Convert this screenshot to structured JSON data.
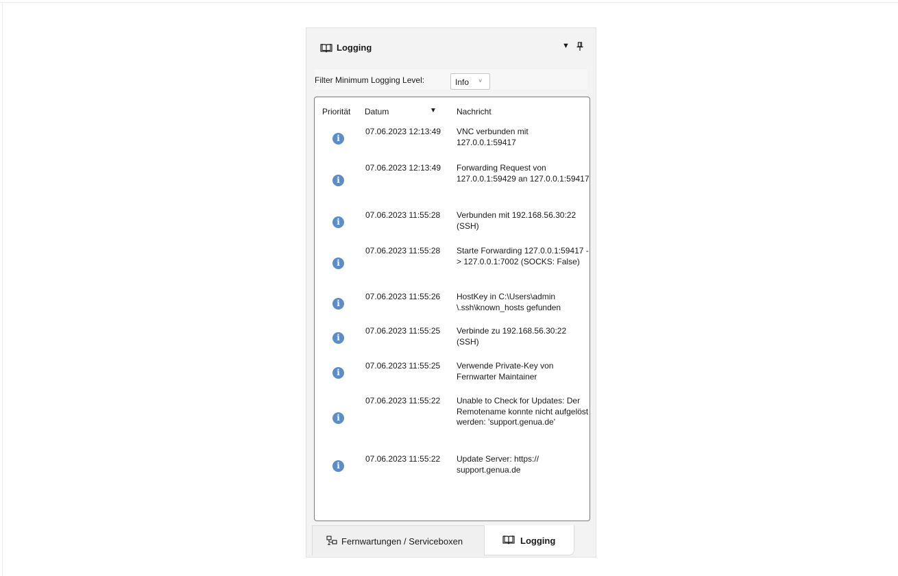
{
  "panel": {
    "title": "Logging",
    "title_icon": "book-icon",
    "menu_icon": "dropdown-arrow-icon",
    "pin_icon": "pin-icon"
  },
  "filter": {
    "label": "Filter Minimum Logging Level:",
    "selected": "Info"
  },
  "table": {
    "columns": [
      "Priorität",
      "Datum",
      "Nachricht"
    ],
    "sort_column": "Datum",
    "sort_direction": "descending",
    "rows": [
      {
        "priority": "info",
        "date": "07.06.2023 12:13:49",
        "message": "VNC verbunden mit 127.0.0.1:59417"
      },
      {
        "priority": "info",
        "date": "07.06.2023 12:13:49",
        "message": "Forwarding Request von 127.0.0.1:59429 an 127.0.0.1:59417"
      },
      {
        "priority": "info",
        "date": "07.06.2023 11:55:28",
        "message": "Verbunden mit 192.168.56.30:22 (SSH)"
      },
      {
        "priority": "info",
        "date": "07.06.2023 11:55:28",
        "message": "Starte Forwarding 127.0.0.1:59417 -> 127.0.0.1:7002 (SOCKS: False)"
      },
      {
        "priority": "info",
        "date": "07.06.2023 11:55:26",
        "message": "HostKey in C:\\Users\\admin \\.ssh\\known_hosts gefunden"
      },
      {
        "priority": "info",
        "date": "07.06.2023 11:55:25",
        "message": "Verbinde zu 192.168.56.30:22 (SSH)"
      },
      {
        "priority": "info",
        "date": "07.06.2023 11:55:25",
        "message": "Verwende Private-Key von Fernwarter Maintainer"
      },
      {
        "priority": "info",
        "date": "07.06.2023 11:55:22",
        "message": "Unable to Check for Updates: Der Remotename konnte nicht aufgelöst werden: 'support.genua.de'"
      },
      {
        "priority": "info",
        "date": "07.06.2023 11:55:22",
        "message": "Update Server: https:// support.genua.de"
      }
    ]
  },
  "tabs": [
    {
      "label": "Fernwartungen / Serviceboxen",
      "icon": "network-icon",
      "active": false
    },
    {
      "label": "Logging",
      "icon": "book-icon",
      "active": true
    }
  ]
}
